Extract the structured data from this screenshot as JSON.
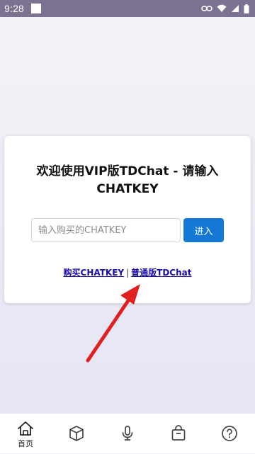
{
  "status_bar": {
    "time": "9:28",
    "icons": [
      "notification-square-icon",
      "link-icon",
      "wifi-icon",
      "signal-icon",
      "battery-icon"
    ]
  },
  "card": {
    "title": "欢迎使用VIP版TDChat - 请输入CHATKEY",
    "input_placeholder": "输入购买的CHATKEY",
    "input_value": "",
    "enter_button_label": "进入",
    "buy_link_label": "购买CHATKEY",
    "separator": "|",
    "normal_link_label": "普通版TDChat"
  },
  "annotation": {
    "arrow_color": "#e02020"
  },
  "bottom_nav": {
    "items": [
      {
        "icon": "home-icon",
        "label": "首页",
        "active": true
      },
      {
        "icon": "cube-icon",
        "label": ""
      },
      {
        "icon": "microphone-icon",
        "label": ""
      },
      {
        "icon": "shopping-bag-icon",
        "label": ""
      },
      {
        "icon": "help-icon",
        "label": ""
      }
    ]
  },
  "colors": {
    "status_bar": "#7c7393",
    "primary_button": "#1478d4",
    "link": "#1a0dab"
  }
}
